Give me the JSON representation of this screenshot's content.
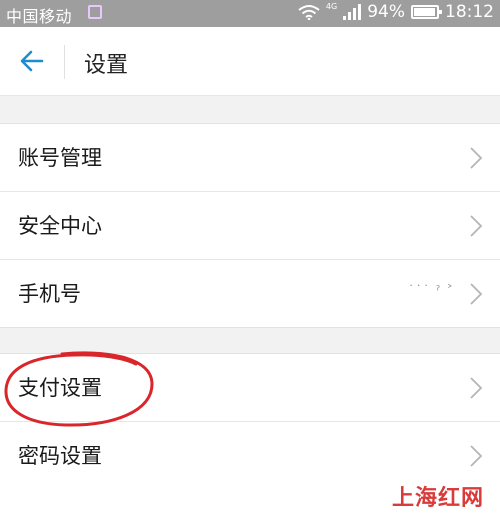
{
  "status_bar": {
    "carrier": "中国移动",
    "network": "4G",
    "battery": "94%",
    "battery_level": 0.94,
    "time": "18:12"
  },
  "header": {
    "title": "设置",
    "back_icon": "arrow-left-icon"
  },
  "groups": [
    {
      "items": [
        {
          "label": "账号管理",
          "chevron": true
        },
        {
          "label": "安全中心",
          "chevron": true
        },
        {
          "label": "手机号",
          "value": "˙˙˙ ˀ ˃",
          "chevron": true
        }
      ]
    },
    {
      "items": [
        {
          "label": "支付设置",
          "chevron": true
        },
        {
          "label": "密码设置",
          "chevron": true
        }
      ]
    }
  ],
  "annotation": {
    "color": "#d9262b"
  },
  "watermark": "上海红网",
  "colors": {
    "accent": "#1f8ccf",
    "watermark": "#d93b3b"
  }
}
